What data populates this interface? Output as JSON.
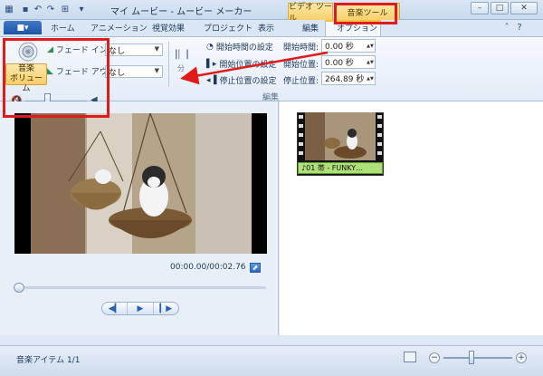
{
  "app": {
    "title": "マイ ムービー - ムービー メーカー"
  },
  "context_tabs": {
    "video": "ビデオ ツール",
    "music": "音楽ツール"
  },
  "tabs": [
    "ホーム",
    "アニメーション",
    "視覚効果",
    "プロジェクト",
    "表示",
    "編集",
    "オプション"
  ],
  "file_menu": "■▾",
  "ribbon": {
    "volume_label_line1": "音楽",
    "volume_label_line2": "ボリューム",
    "fade_in_label": "フェード イン:",
    "fade_out_label": "フェード アウト:",
    "fade_in_value": "なし",
    "fade_out_value": "なし",
    "set_start_time": "開始時間の設定",
    "set_start_point": "開始位置の設定",
    "set_end_point": "停止位置の設定",
    "start_time_label": "開始時間:",
    "start_point_label": "開始位置:",
    "end_point_label": "停止位置:",
    "start_time_value": "0.00 秒",
    "start_point_value": "0.00 秒",
    "end_point_value": "264.89 秒",
    "split_label": "分",
    "group_label": "編集",
    "volume_level": 0.35
  },
  "player": {
    "timecode": "00:00.00/00:02.76"
  },
  "clip": {
    "music_label": "01 帯 - FUNKY…"
  },
  "status": {
    "text": "音楽アイテム 1/1"
  },
  "icons": [
    "save-icon",
    "undo-icon",
    "redo-icon",
    "layout-icon",
    "volume-icon",
    "fade-in-icon",
    "fade-out-icon",
    "speaker-mute-icon",
    "speaker-loud-icon",
    "play-icon",
    "prev-frame-icon",
    "next-frame-icon",
    "popout-icon",
    "music-note-icon",
    "zoom-in-icon",
    "zoom-out-icon"
  ],
  "colors": {
    "highlight": "#e01b1b",
    "context_tab": "#f7d06d",
    "music_bar": "#aee07a",
    "accent": "#1d54a3"
  }
}
